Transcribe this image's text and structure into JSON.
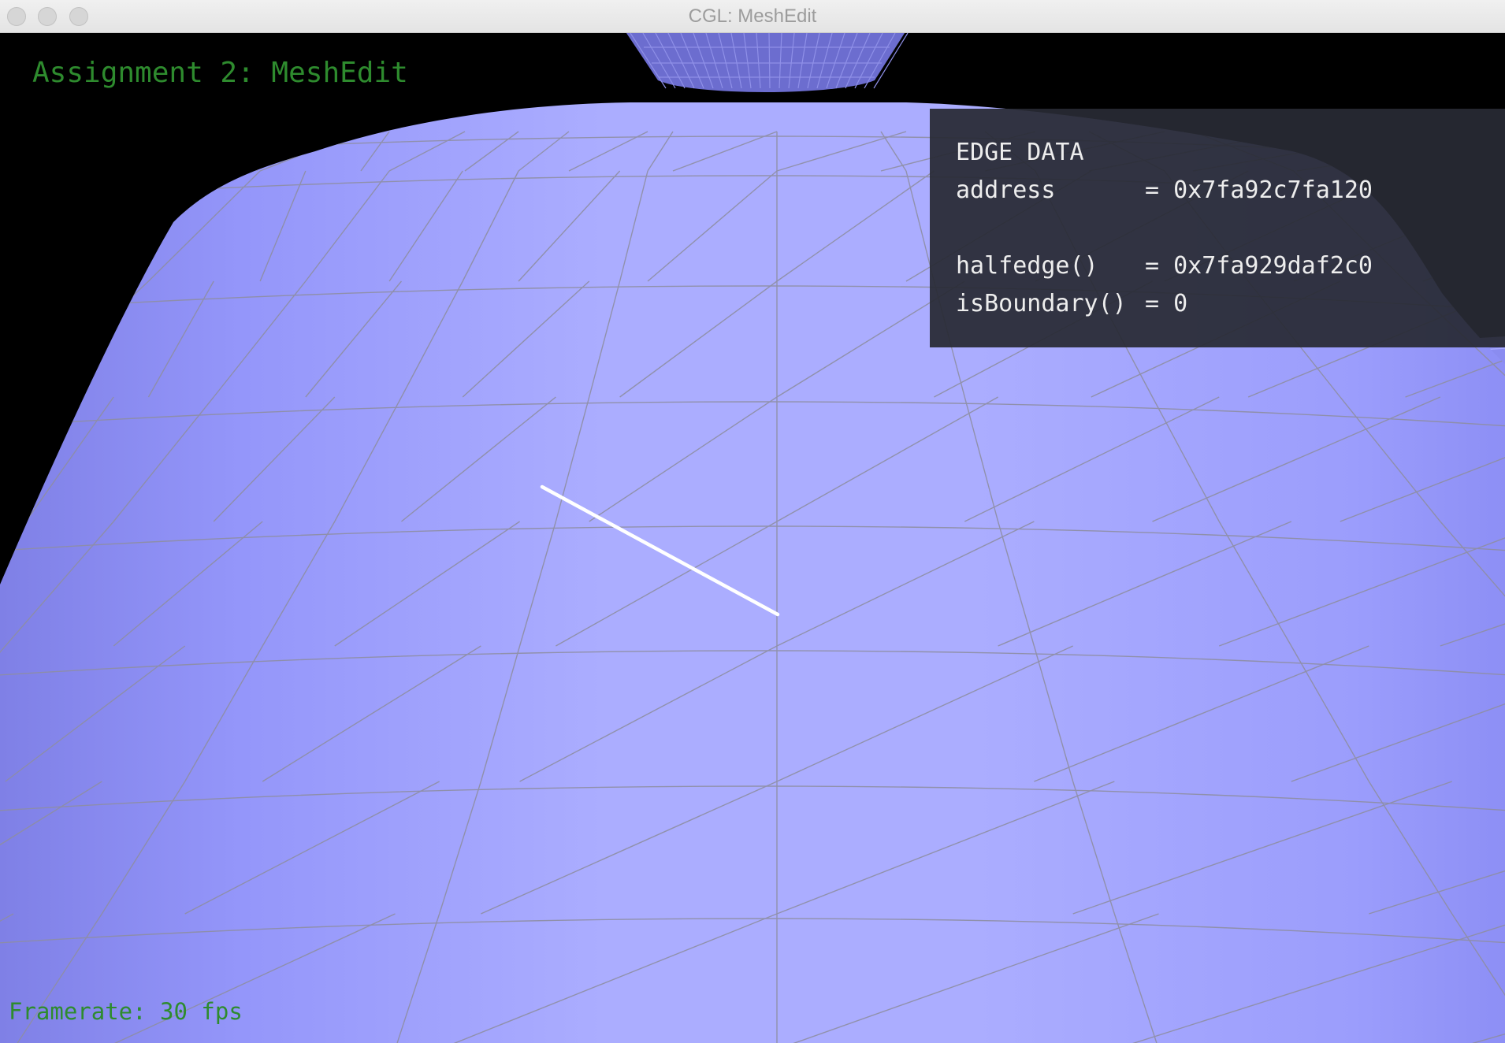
{
  "window": {
    "title": "CGL: MeshEdit"
  },
  "viewport": {
    "overlay_title": "Assignment 2: MeshEdit",
    "framerate": "Framerate: 30 fps",
    "mesh_color": "#a9abff",
    "wire_color": "#8c8c9c",
    "selected_edge_color": "#ffffff"
  },
  "edge_data": {
    "heading": "EDGE DATA",
    "rows": [
      {
        "key": "address",
        "eq": "= ",
        "value": "0x7fa92c7fa120"
      },
      {
        "key": "halfedge()",
        "eq": "= ",
        "value": "0x7fa929daf2c0"
      },
      {
        "key": "isBoundary()",
        "eq": "= ",
        "value": "0"
      }
    ]
  }
}
